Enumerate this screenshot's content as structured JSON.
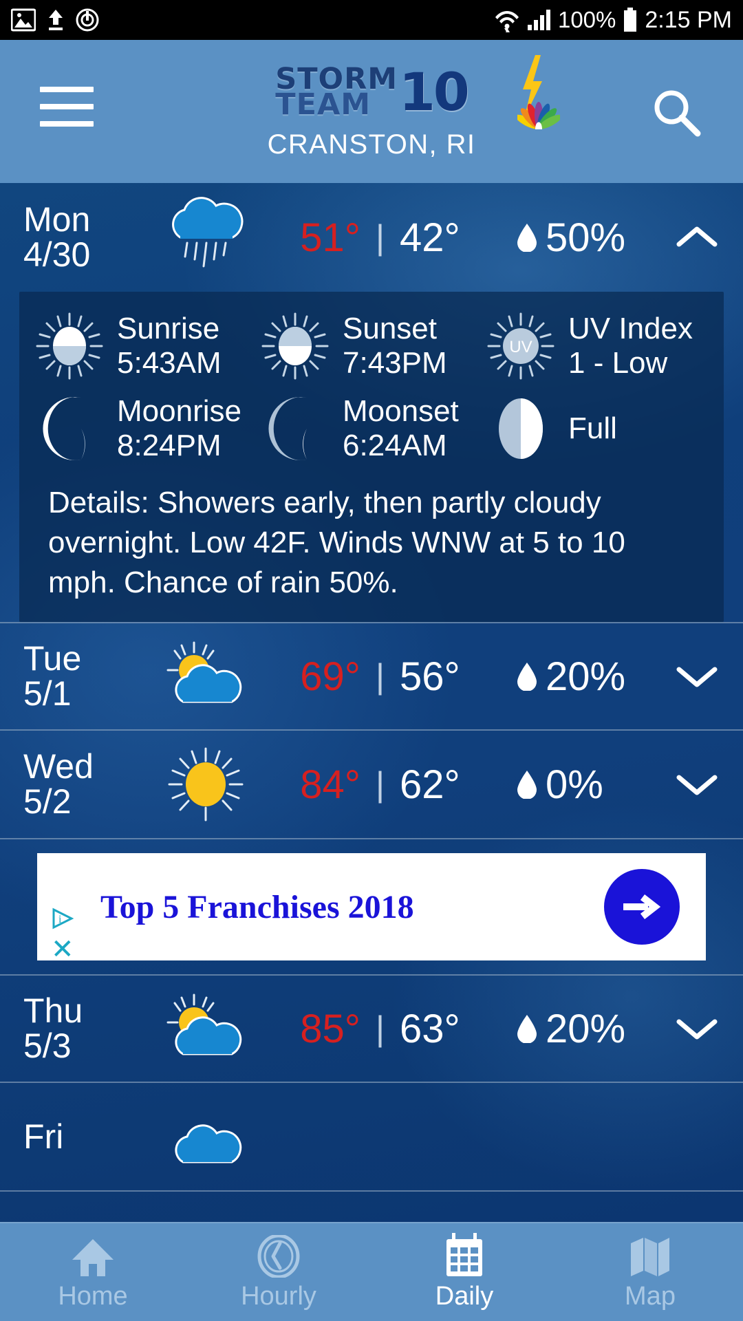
{
  "status_bar": {
    "left_icons": [
      "image-icon",
      "upload-icon",
      "power-ring-icon"
    ],
    "right_icons": [
      "wifi-icon",
      "signal-icon",
      "battery-icon"
    ],
    "battery": "100%",
    "time": "2:15 PM"
  },
  "header": {
    "menu_icon": "hamburger-icon",
    "logo_line1": "STORM",
    "logo_line2": "TEAM",
    "logo_number": "10",
    "logo_bolt": "lightning-bolt-icon",
    "logo_peacock": "nbc-peacock-icon",
    "location": "CRANSTON, RI",
    "search_icon": "search-icon"
  },
  "days": [
    {
      "day": "Mon",
      "date": "4/30",
      "icon": "rain-cloud-icon",
      "high": "51°",
      "low": "42°",
      "separator": "|",
      "pop": "50%",
      "chevron": "chevron-up-icon",
      "expanded": true,
      "astro": [
        {
          "icon": "sunrise-icon",
          "label": "Sunrise",
          "value": "5:43AM"
        },
        {
          "icon": "sunset-icon",
          "label": "Sunset",
          "value": "7:43PM"
        },
        {
          "icon": "uv-icon",
          "label": "UV Index",
          "value": "1 - Low"
        },
        {
          "icon": "moonrise-icon",
          "label": "Moonrise",
          "value": "8:24PM"
        },
        {
          "icon": "moonset-icon",
          "label": "Moonset",
          "value": "6:24AM"
        },
        {
          "icon": "moon-phase-icon",
          "label": "Full",
          "value": ""
        }
      ],
      "details": "Details: Showers early, then partly cloudy overnight. Low 42F. Winds WNW at 5 to 10 mph. Chance of rain 50%."
    },
    {
      "day": "Tue",
      "date": "5/1",
      "icon": "partly-cloudy-icon",
      "high": "69°",
      "low": "56°",
      "separator": "|",
      "pop": "20%",
      "chevron": "chevron-down-icon",
      "expanded": false
    },
    {
      "day": "Wed",
      "date": "5/2",
      "icon": "sunny-icon",
      "high": "84°",
      "low": "62°",
      "separator": "|",
      "pop": "0%",
      "chevron": "chevron-down-icon",
      "expanded": false
    },
    {
      "day": "Thu",
      "date": "5/3",
      "icon": "partly-cloudy-icon",
      "high": "85°",
      "low": "63°",
      "separator": "|",
      "pop": "20%",
      "chevron": "chevron-down-icon",
      "expanded": false
    },
    {
      "day": "Fri",
      "date": "",
      "icon": "cloud-icon",
      "high": "",
      "low": "",
      "separator": "",
      "pop": "",
      "chevron": "",
      "expanded": false
    }
  ],
  "ad": {
    "adchoices_icon": "adchoices-icon",
    "close_icon": "close-icon",
    "headline": "Top 5 Franchises 2018",
    "cta_icon": "arrow-right-icon"
  },
  "bottom_nav": [
    {
      "icon": "home-icon",
      "label": "Home",
      "active": false
    },
    {
      "icon": "clock-icon",
      "label": "Hourly",
      "active": false
    },
    {
      "icon": "calendar-icon",
      "label": "Daily",
      "active": true
    },
    {
      "icon": "map-icon",
      "label": "Map",
      "active": false
    }
  ],
  "colors": {
    "header_blue": "#5b91c4",
    "body_blue": "#0f3f7b",
    "high_temp_red": "#d62020",
    "ad_blue": "#1a13d8",
    "ad_accent_cyan": "#1ca8c4",
    "sun_yellow": "#f9c41b",
    "cloud_blue": "#1787d0"
  }
}
